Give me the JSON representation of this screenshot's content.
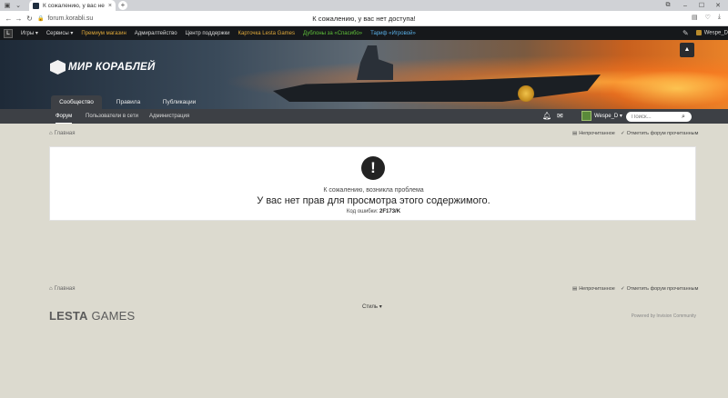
{
  "browser": {
    "tab_title": "К сожалению, у вас не",
    "url": "forum.korabli.su",
    "page_title": "К сожалению, у вас нет доступа!"
  },
  "servicebar": {
    "items": [
      {
        "label": "Игры ▾",
        "color": "#d8d8d8"
      },
      {
        "label": "Сервисы ▾",
        "color": "#d8d8d8"
      },
      {
        "label": "Премиум магазин",
        "color": "#e0a93a"
      },
      {
        "label": "Адмиралтейство",
        "color": "#d8d8d8"
      },
      {
        "label": "Центр поддержки",
        "color": "#d8d8d8"
      },
      {
        "label": "Карточка Lesta Games",
        "color": "#e0a93a"
      },
      {
        "label": "Дублоны за «Спасибо»",
        "color": "#5fc13a"
      },
      {
        "label": "Тариф «Игровой»",
        "color": "#5ab0e8"
      }
    ],
    "user": "Wespe_D"
  },
  "brand": {
    "logo_text": "МИР КОРАБЛЕЙ"
  },
  "primary_tabs": [
    {
      "label": "Сообщество",
      "active": true
    },
    {
      "label": "Правила",
      "active": false
    },
    {
      "label": "Публикации",
      "active": false
    }
  ],
  "secondary_nav": [
    {
      "label": "Форум",
      "active": true
    },
    {
      "label": "Пользователи в сети",
      "active": false
    },
    {
      "label": "Администрация",
      "active": false
    }
  ],
  "user": {
    "name": "Wespe_D ▾"
  },
  "search": {
    "placeholder": "Поиск..."
  },
  "breadcrumb": {
    "home": "Главная",
    "unread": "Непрочитанное",
    "mark_read": "Отметить форум прочитанным"
  },
  "error": {
    "icon_glyph": "!",
    "subtitle": "К сожалению, возникла проблема",
    "message": "У вас нет прав для просмотра этого содержимого.",
    "code_label": "Код ошибки:",
    "code": "2F173/K"
  },
  "footer": {
    "style_label": "Стиль ▾",
    "lesta_bold": "LESTA",
    "lesta_rest": " GAMES",
    "powered": "Powered by Invision Community"
  }
}
